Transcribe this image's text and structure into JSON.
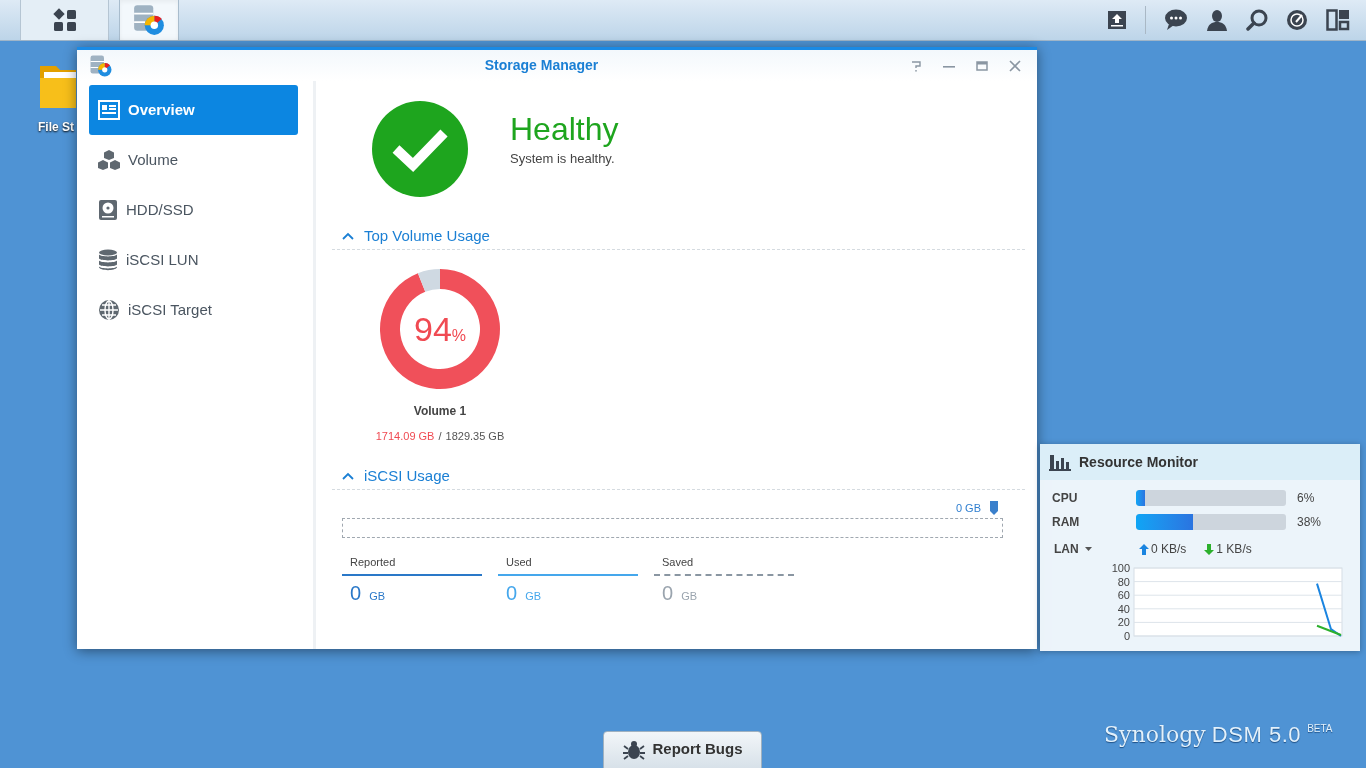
{
  "taskbar": {
    "buttons": [
      {
        "kind": "main-menu",
        "selected": false
      },
      {
        "kind": "storage-manager",
        "selected": true
      }
    ],
    "tray": [
      {
        "kind": "upload"
      },
      {
        "kind": "chat"
      },
      {
        "kind": "user"
      },
      {
        "kind": "search"
      },
      {
        "kind": "gauge"
      },
      {
        "kind": "widgets"
      }
    ]
  },
  "desktop": {
    "icons": [
      {
        "label": "File St"
      }
    ],
    "brand": {
      "name": "Synology",
      "product": "DSM 5.0",
      "tag": "BETA"
    }
  },
  "window": {
    "title": "Storage Manager"
  },
  "sidebar": {
    "items": [
      {
        "label": "Overview",
        "selected": true
      },
      {
        "label": "Volume",
        "selected": false
      },
      {
        "label": "HDD/SSD",
        "selected": false
      },
      {
        "label": "iSCSI LUN",
        "selected": false
      },
      {
        "label": "iSCSI Target",
        "selected": false
      }
    ]
  },
  "status": {
    "healthy": true,
    "title": "Healthy",
    "message": "System is healthy."
  },
  "top_volume_usage": {
    "heading": "Top Volume Usage",
    "expanded": true,
    "volumes": [
      {
        "name": "Volume 1",
        "percent": "94",
        "unit": "%",
        "chart_data": {
          "type": "donut",
          "values": [
            94,
            6
          ]
        },
        "used": "1714.09 GB",
        "separator": "/",
        "total": "1829.35 GB"
      }
    ]
  },
  "iscsi_usage": {
    "heading": "iSCSI Usage",
    "expanded": true,
    "marker": "0 GB",
    "legend": [
      {
        "label": "Reported",
        "value": "0",
        "unit": "GB",
        "kind": "reported"
      },
      {
        "label": "Used",
        "value": "0",
        "unit": "GB",
        "kind": "used"
      },
      {
        "label": "Saved",
        "value": "0",
        "unit": "GB",
        "kind": "saved"
      }
    ]
  },
  "resource_monitor": {
    "title": "Resource Monitor",
    "meters": [
      {
        "name": "CPU",
        "level": 0.06,
        "reading": "6%"
      },
      {
        "name": "RAM",
        "level": 0.38,
        "reading": "38%"
      }
    ],
    "lan": {
      "label": "LAN",
      "upload": "0 KB/s",
      "download": "1 KB/s",
      "chart": {
        "y_labels": [
          "100",
          "80",
          "60",
          "40",
          "20",
          "0"
        ]
      }
    }
  },
  "report_bugs": {
    "label": "Report Bugs"
  }
}
